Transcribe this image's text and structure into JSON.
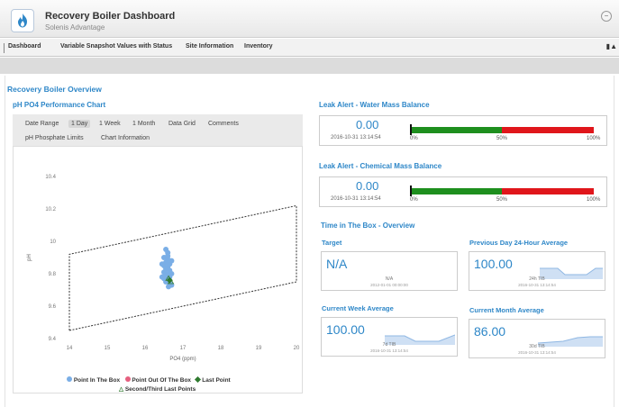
{
  "header": {
    "title": "Recovery Boiler Dashboard",
    "subtitle": "Solenis Advantage",
    "minimize_glyph": "−"
  },
  "nav": {
    "tabs": [
      {
        "label": "Dashboard"
      },
      {
        "label": "Variable Snapshot Values with Status"
      },
      {
        "label": "Site Information"
      },
      {
        "label": "Inventory"
      }
    ],
    "right_glyph": "▮▲"
  },
  "overview": {
    "title": "Recovery Boiler Overview"
  },
  "chart_panel": {
    "title": "pH PO4 Performance Chart",
    "tabs_row1": [
      "Date Range",
      "1 Day",
      "1 Week",
      "1 Month",
      "Data Grid",
      "Comments"
    ],
    "tabs_row2": [
      "pH Phosphate Limits",
      "Chart Information"
    ],
    "active_tab": "1 Day"
  },
  "chart_data": {
    "type": "scatter",
    "xlabel": "PO4 (ppm)",
    "ylabel": "pH",
    "xlim": [
      14,
      20
    ],
    "ylim": [
      9.4,
      10.4
    ],
    "x_ticks": [
      "14",
      "15",
      "16",
      "17",
      "18",
      "19",
      "20"
    ],
    "y_ticks": [
      "10.4",
      "10.2",
      "10",
      "9.8",
      "9.6",
      "9.4"
    ],
    "box": [
      [
        14.0,
        9.45
      ],
      [
        14.0,
        9.92
      ],
      [
        20.0,
        10.22
      ],
      [
        20.0,
        9.75
      ]
    ],
    "series": [
      {
        "name": "Point In The Box",
        "color": "#7aaee6",
        "points": [
          [
            16.55,
            9.95
          ],
          [
            16.6,
            9.93
          ],
          [
            16.5,
            9.9
          ],
          [
            16.6,
            9.89
          ],
          [
            16.55,
            9.87
          ],
          [
            16.65,
            9.86
          ],
          [
            16.5,
            9.85
          ],
          [
            16.6,
            9.84
          ],
          [
            16.55,
            9.83
          ],
          [
            16.65,
            9.82
          ],
          [
            16.5,
            9.81
          ],
          [
            16.6,
            9.8
          ],
          [
            16.55,
            9.79
          ],
          [
            16.65,
            9.78
          ],
          [
            16.5,
            9.77
          ],
          [
            16.6,
            9.76
          ],
          [
            16.55,
            9.75
          ],
          [
            16.65,
            9.74
          ],
          [
            16.7,
            9.73
          ],
          [
            16.6,
            9.91
          ],
          [
            16.7,
            9.88
          ],
          [
            16.45,
            9.86
          ],
          [
            16.7,
            9.8
          ],
          [
            16.45,
            9.78
          ],
          [
            16.62,
            9.72
          ]
        ]
      },
      {
        "name": "Point Out Of The Box",
        "color": "#e5607f",
        "points": []
      },
      {
        "name": "Last Point",
        "color": "#2f7a2f",
        "points": [
          [
            16.65,
            9.76
          ]
        ]
      },
      {
        "name": "Second/Third Last Points",
        "color": "#2f7a2f",
        "points": [
          [
            16.62,
            9.77
          ],
          [
            16.68,
            9.75
          ]
        ]
      }
    ],
    "legend": [
      {
        "label": "Point In The Box",
        "color": "#7aaee6",
        "symbol": "circle"
      },
      {
        "label": "Point Out Of The Box",
        "color": "#e5607f",
        "symbol": "circle"
      },
      {
        "label": "Last Point",
        "color": "#2f7a2f",
        "symbol": "diamond"
      },
      {
        "label": "Second/Third Last Points",
        "color": "#2f7a2f",
        "symbol": "triangle"
      }
    ]
  },
  "leak_water": {
    "title": "Leak Alert - Water Mass Balance",
    "value": "0.00",
    "timestamp": "2016-10-31 13:14:54",
    "green_to": 0.5,
    "labels": [
      "0%",
      "50%",
      "100%"
    ],
    "green": "#1e8f1e",
    "red": "#e0161b"
  },
  "leak_chem": {
    "title": "Leak Alert - Chemical Mass Balance",
    "value": "0.00",
    "timestamp": "2016-10-31 13:14:54",
    "green_to": 0.5,
    "labels": [
      "0%",
      "50%",
      "100%"
    ]
  },
  "time_in_box": {
    "title": "Time in The Box - Overview",
    "kpis": [
      {
        "title": "Target",
        "value": "N/A",
        "sub1": "N/A",
        "sub2": "2012-01-01 00:00:00"
      },
      {
        "title": "Previous Day 24-Hour Average",
        "value": "100.00",
        "sub1": "24h TIB",
        "sub2": "2016-10-31 13:14:54"
      },
      {
        "title": "Current Week Average",
        "value": "100.00",
        "sub1": "7d TIB",
        "sub2": "2016-10-31 13:14:54"
      },
      {
        "title": "Current Month Average",
        "value": "86.00",
        "sub1": "30d TIB",
        "sub2": "2016-10-31 13:14:54"
      }
    ]
  }
}
